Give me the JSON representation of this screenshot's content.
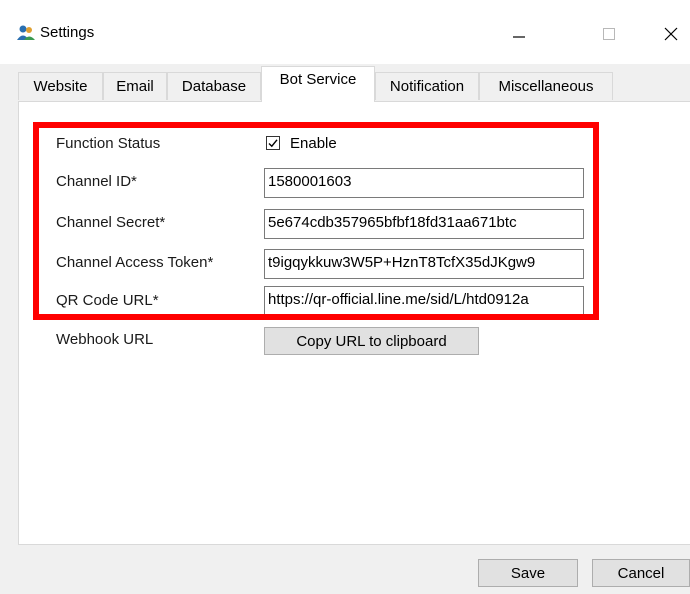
{
  "window": {
    "title": "Settings",
    "icon": "gear-people-icon",
    "controls": {
      "minimize": "—",
      "maximize": "☐",
      "close": "✕"
    }
  },
  "tabs": [
    {
      "label": "Website",
      "active": false
    },
    {
      "label": "Email",
      "active": false
    },
    {
      "label": "Database",
      "active": false
    },
    {
      "label": "Bot Service",
      "active": true
    },
    {
      "label": "Notification",
      "active": false
    },
    {
      "label": "Miscellaneous",
      "active": false
    }
  ],
  "form": {
    "function_status": {
      "label": "Function Status",
      "checkbox_label": "Enable",
      "checked": true
    },
    "channel_id": {
      "label": "Channel ID*",
      "value": "1580001603"
    },
    "channel_secret": {
      "label": "Channel Secret*",
      "value": "5e674cdb357965bfbf18fd31aa671btc"
    },
    "channel_access_token": {
      "label": "Channel Access Token*",
      "value": "t9igqykkuw3W5P+HznT8TcfX35dJKgw9"
    },
    "qr_code_url": {
      "label": "QR Code URL*",
      "value": "https://qr-official.line.me/sid/L/htd0912a"
    },
    "webhook_url": {
      "label": "Webhook URL",
      "button_label": "Copy URL to clipboard"
    }
  },
  "footer": {
    "save_label": "Save",
    "cancel_label": "Cancel"
  },
  "colors": {
    "highlight": "#ff0000",
    "panel_bg": "#ffffff",
    "window_bg": "#f0f0f0"
  }
}
